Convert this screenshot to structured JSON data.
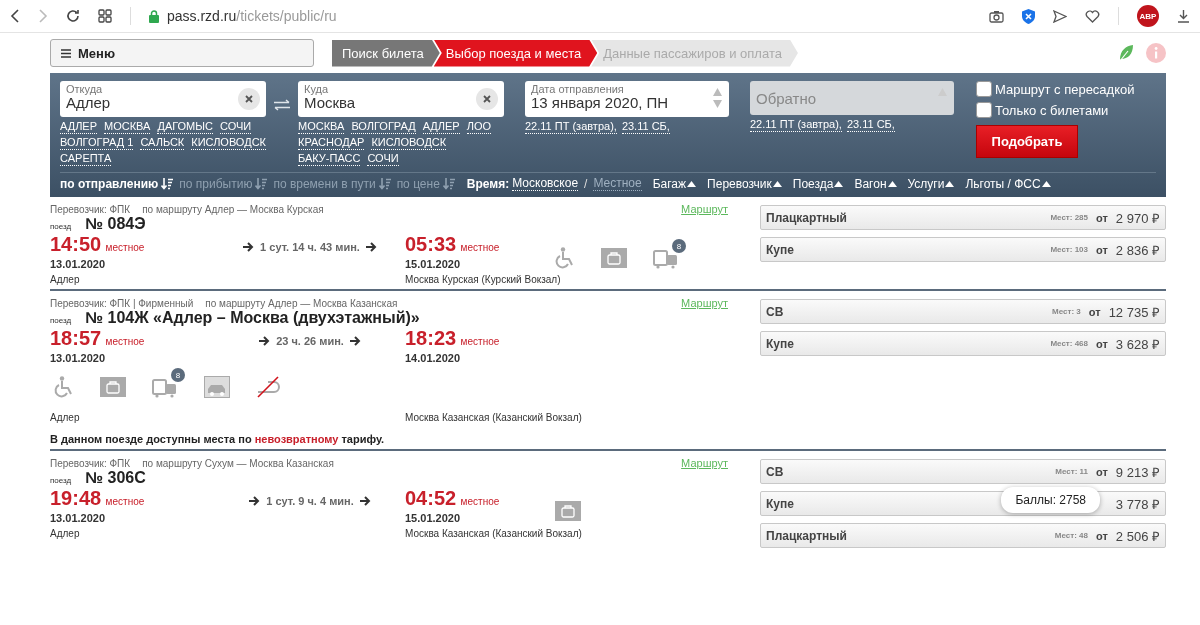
{
  "browser": {
    "url_host": "pass.rzd.ru",
    "url_path": "/tickets/public/ru",
    "adblock_label": "ABP"
  },
  "header": {
    "menu_label": "Меню",
    "steps": [
      {
        "label": "Поиск билета",
        "completed": true,
        "selected": false
      },
      {
        "label": "Выбор поезда и места",
        "completed": false,
        "selected": true
      },
      {
        "label": "Данные пассажиров и оплата",
        "completed": false,
        "selected": false
      }
    ]
  },
  "search": {
    "from": {
      "label": "Откуда",
      "value": "Адлер",
      "suggestions": [
        "АДЛЕР",
        "МОСКВА",
        "ДАГОМЫС",
        "СОЧИ",
        "ВОЛГОГРАД 1",
        "САЛЬСК",
        "КИСЛОВОДСК",
        "САРЕПТА"
      ]
    },
    "to": {
      "label": "Куда",
      "value": "Москва",
      "suggestions": [
        "МОСКВА",
        "ВОЛГОГРАД",
        "АДЛЕР",
        "ЛОО",
        "КРАСНОДАР",
        "КИСЛОВОДСК",
        "БАКУ-ПАСС",
        "СОЧИ"
      ]
    },
    "date": {
      "label": "Дата отправления",
      "value": "13 января 2020, ПН",
      "quick": [
        "22.11 ПТ (завтра),",
        "23.11 СБ,"
      ]
    },
    "return": {
      "placeholder": "Обратно",
      "disabled": true,
      "quick": [
        "22.11 ПТ (завтра),",
        "23.11 СБ,"
      ]
    },
    "options": [
      {
        "label": "Маршрут с пересадкой",
        "checked": false
      },
      {
        "label": "Только с билетами",
        "checked": false
      }
    ],
    "submit": "Подобрать",
    "sort": [
      {
        "label": "по отправлению",
        "selected": true
      },
      {
        "label": "по прибытию",
        "selected": false
      },
      {
        "label": "по времени в пути",
        "selected": false
      },
      {
        "label": "по цене",
        "selected": false
      }
    ],
    "time": {
      "label": "Время:",
      "separator": "/",
      "options": [
        {
          "label": "Московское",
          "selected": true
        },
        {
          "label": "Местное",
          "selected": false
        }
      ]
    },
    "filters": [
      "Багаж",
      "Перевозчик",
      "Поезда",
      "Вагон",
      "Услуги",
      "Льготы / ФСС"
    ]
  },
  "trains": [
    {
      "carrier": "Перевозчик: ФПК",
      "route": "по маршруту Адлер — Москва Курская",
      "route_link": "Маршрут",
      "number_label": "поезд",
      "number": "№ 084Э",
      "dep_time": "14:50",
      "dep_zone": "местное",
      "dep_date": "13.01.2020",
      "duration": "1 сут. 14 ч. 43 мин.",
      "arr_time": "05:33",
      "arr_zone": "местное",
      "arr_date": "15.01.2020",
      "dep_station": "Адлер",
      "arr_station": "Москва Курская (Курский Вокзал)",
      "icons_below": false,
      "icons": [
        {
          "kind": "wheelchair"
        },
        {
          "kind": "baggage"
        },
        {
          "kind": "luggage",
          "badge": "8"
        }
      ],
      "classes": [
        {
          "name": "Плацкартный",
          "seats": "Мест: 285",
          "from": "от",
          "price": "2 970 ₽"
        },
        {
          "name": "Купе",
          "seats": "Мест: 103",
          "from": "от",
          "price": "2 836 ₽"
        }
      ]
    },
    {
      "carrier": "Перевозчик: ФПК | Фирменный",
      "route": "по маршруту Адлер — Москва Казанская",
      "route_link": "Маршрут",
      "number_label": "поезд",
      "number": "№ 104Ж «Адлер – Москва (двухэтажный)»",
      "dep_time": "18:57",
      "dep_zone": "местное",
      "dep_date": "13.01.2020",
      "duration": "23 ч. 26 мин.",
      "arr_time": "18:23",
      "arr_zone": "местное",
      "arr_date": "14.01.2020",
      "dep_station": "Адлер",
      "arr_station": "Москва Казанская (Казанский Вокзал)",
      "icons_below": true,
      "icons": [
        {
          "kind": "wheelchair"
        },
        {
          "kind": "baggage"
        },
        {
          "kind": "luggage",
          "badge": "8"
        },
        {
          "kind": "car"
        },
        {
          "kind": "no-return"
        }
      ],
      "note": {
        "before": "В данном поезде доступны места по",
        "link": "невозвратному",
        "after": "тарифу."
      },
      "classes": [
        {
          "name": "СВ",
          "seats": "Мест: 3",
          "from": "от",
          "price": "12 735 ₽"
        },
        {
          "name": "Купе",
          "seats": "Мест: 468",
          "from": "от",
          "price": "3 628 ₽"
        }
      ]
    },
    {
      "carrier": "Перевозчик: ФПК",
      "route": "по маршруту Сухум — Москва Казанская",
      "route_link": "Маршрут",
      "number_label": "поезд",
      "number": "№ 306С",
      "dep_time": "19:48",
      "dep_zone": "местное",
      "dep_date": "13.01.2020",
      "duration": "1 сут. 9 ч. 4 мин.",
      "arr_time": "04:52",
      "arr_zone": "местное",
      "arr_date": "15.01.2020",
      "dep_station": "Адлер",
      "arr_station": "Москва Казанская (Казанский Вокзал)",
      "icons_below": false,
      "icons": [
        {
          "kind": "baggage"
        }
      ],
      "classes": [
        {
          "name": "СВ",
          "seats": "Мест: 11",
          "from": "от",
          "price": "9 213 ₽"
        },
        {
          "name": "Купе",
          "price": "3 778 ₽",
          "tooltip": "Баллы: 2758"
        },
        {
          "name": "Плацкартный",
          "seats": "Мест: 48",
          "from": "от",
          "price": "2 506 ₽"
        }
      ]
    }
  ]
}
